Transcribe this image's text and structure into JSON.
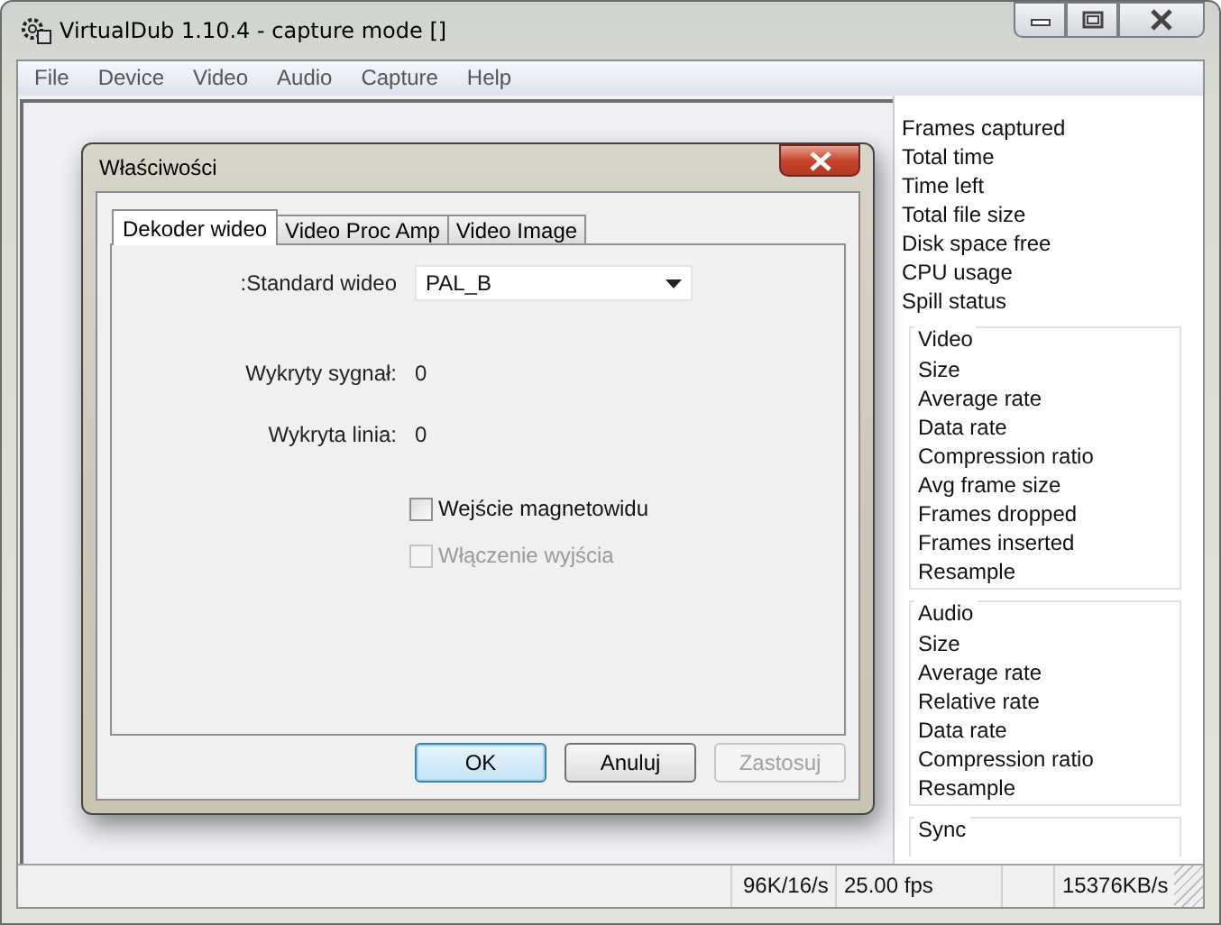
{
  "window": {
    "title": "VirtualDub 1.10.4 - capture mode []"
  },
  "menu": [
    {
      "label": "File"
    },
    {
      "label": "Device"
    },
    {
      "label": "Video"
    },
    {
      "label": "Audio"
    },
    {
      "label": "Capture"
    },
    {
      "label": "Help"
    }
  ],
  "stats_panel": {
    "items": [
      "Frames captured",
      "Total time",
      "Time left",
      "Total file size",
      "Disk space free",
      "CPU usage",
      "Spill status"
    ],
    "groups": [
      {
        "title": "Video",
        "items": [
          "Size",
          "Average rate",
          "Data rate",
          "Compression ratio",
          "Avg frame size",
          "Frames dropped",
          "Frames inserted",
          "Resample"
        ]
      },
      {
        "title": "Audio",
        "items": [
          "Size",
          "Average rate",
          "Relative rate",
          "Data rate",
          "Compression ratio",
          "Resample"
        ]
      },
      {
        "title": "Sync"
      }
    ]
  },
  "status_bar": [
    "96K/16/s",
    "25.00 fps",
    "15376KB/s"
  ],
  "dialog": {
    "title": "Właściwości",
    "tabs": [
      {
        "label": "Dekoder wideo",
        "selected": true
      },
      {
        "label": "Video Proc Amp",
        "selected": false
      },
      {
        "label": "Video Image",
        "selected": false
      }
    ],
    "standard": {
      "label": ":Standard wideo",
      "value": "PAL_B"
    },
    "readouts": [
      {
        "label": "Wykryty sygnał:",
        "value": "0"
      },
      {
        "label": "Wykryta linia:",
        "value": "0"
      }
    ],
    "checkboxes": [
      {
        "label": "Wejście magnetowidu",
        "checked": false,
        "disabled": false
      },
      {
        "label": "Włączenie wyjścia",
        "checked": false,
        "disabled": true
      }
    ],
    "buttons": [
      {
        "label": "OK",
        "kind": "default",
        "disabled": false
      },
      {
        "label": "Anuluj",
        "kind": "normal",
        "disabled": false
      },
      {
        "label": "Zastosuj",
        "kind": "normal",
        "disabled": true
      }
    ]
  }
}
